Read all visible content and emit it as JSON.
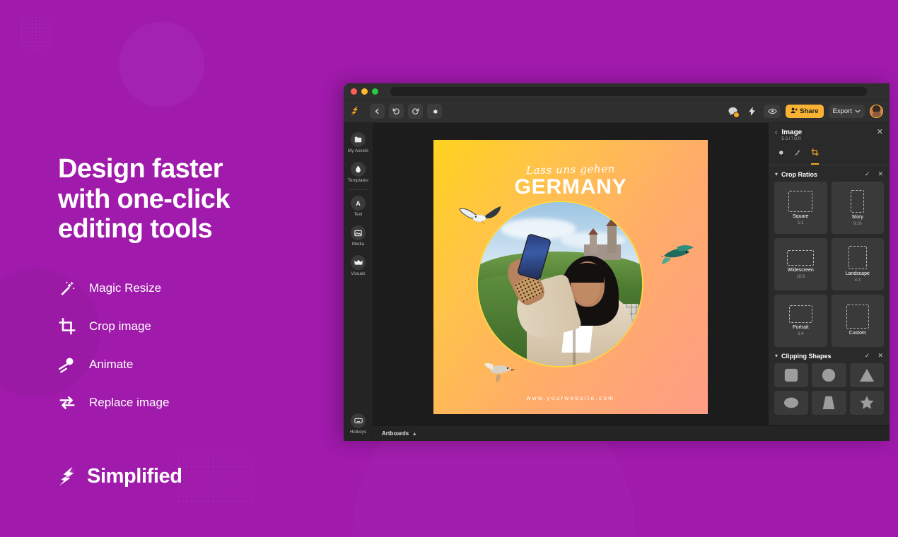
{
  "brand": {
    "accent_purple": "#a01aac",
    "accent_yellow": "#f9b233",
    "logo_text": "Simplified"
  },
  "marketing": {
    "headline": "Design faster\nwith one-click\nediting tools",
    "features": [
      {
        "icon": "magic-wand-icon",
        "label": "Magic Resize"
      },
      {
        "icon": "crop-icon",
        "label": "Crop image"
      },
      {
        "icon": "animate-icon",
        "label": "Animate"
      },
      {
        "icon": "replace-image-icon",
        "label": "Replace image"
      }
    ]
  },
  "app": {
    "toolbar": {
      "back_icon": "chevron-left-icon",
      "undo_icon": "undo-icon",
      "redo_icon": "redo-icon",
      "settings_icon": "gear-icon",
      "comment_icon": "comment-icon",
      "bolt_icon": "lightning-bolt-icon",
      "preview_icon": "eye-icon",
      "share_label": "Share",
      "export_label": "Export"
    },
    "sidebar": {
      "items": [
        {
          "icon": "folder-icon",
          "label": "My Assets"
        },
        {
          "icon": "droplet-icon",
          "label": "Templates"
        },
        {
          "icon": "text-icon",
          "label": "Text"
        },
        {
          "icon": "media-icon",
          "label": "Media"
        },
        {
          "icon": "crown-icon",
          "label": "Visuals"
        }
      ],
      "bottom": {
        "icon": "keyboard-icon",
        "label": "Hotkeys"
      }
    },
    "bottom_bar": {
      "artboards_label": "Artboards",
      "chevron": "chevron-up-icon"
    },
    "panel": {
      "title": "Image",
      "subtitle": "EDITOR",
      "tabs": [
        {
          "icon": "gear-icon",
          "active": false
        },
        {
          "icon": "magic-wand-icon",
          "active": false
        },
        {
          "icon": "crop-icon",
          "active": true
        }
      ],
      "crop_section": {
        "title": "Crop Ratios",
        "ratios": [
          {
            "name": "Square",
            "value": "1:1"
          },
          {
            "name": "Story",
            "value": "9:16"
          },
          {
            "name": "Widescreen",
            "value": "16:9"
          },
          {
            "name": "Landscape",
            "value": "4:3"
          },
          {
            "name": "Portrait",
            "value": "3:4"
          },
          {
            "name": "Custom",
            "value": ""
          }
        ]
      },
      "shapes_section": {
        "title": "Clipping Shapes",
        "shapes": [
          "rounded-square-shape",
          "circle-shape",
          "triangle-shape",
          "ellipse-shape",
          "trapezoid-shape",
          "star-shape"
        ]
      }
    },
    "artboard": {
      "script_text": "Lass uns gehen",
      "title_text": "GERMANY",
      "url_text": "www.yourwebsite.com"
    }
  }
}
